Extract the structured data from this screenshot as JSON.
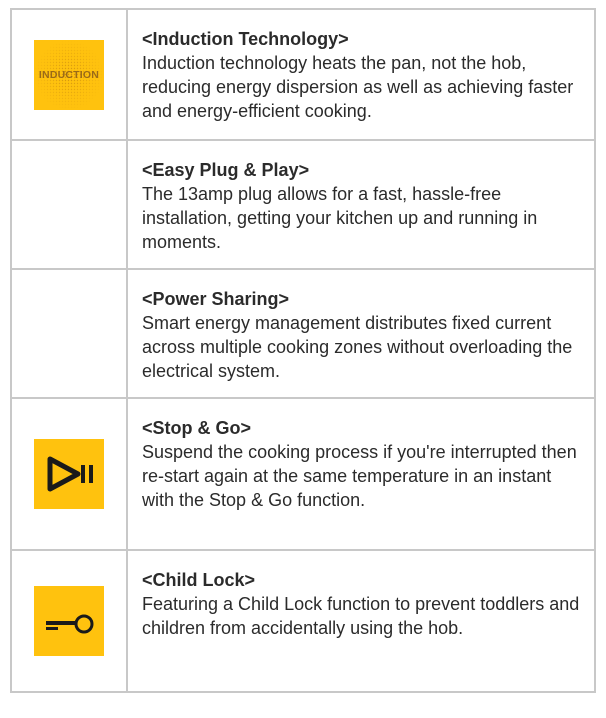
{
  "features": [
    {
      "icon": "induction-badge-icon",
      "icon_text": "INDUCTION",
      "title": "<Induction Technology>",
      "description": "Induction technology heats the pan, not the hob, reducing energy dispersion as well as achieving faster and energy-efficient cooking."
    },
    {
      "icon": "",
      "title": "<Easy Plug & Play>",
      "description": "The 13amp plug allows for a fast, hassle-free installation, getting your kitchen up and running in moments."
    },
    {
      "icon": "",
      "title": "<Power Sharing>",
      "description": "Smart energy management distributes fixed current across multiple cooking zones without overloading the electrical system."
    },
    {
      "icon": "play-pause-icon",
      "title": "<Stop & Go>",
      "description": "Suspend the cooking process if you're interrupted then re-start again at the same temperature in an instant with the Stop & Go function."
    },
    {
      "icon": "key-icon",
      "title": "<Child Lock>",
      "description": "Featuring a Child Lock function to prevent toddlers and children from accidentally using the hob."
    }
  ],
  "colors": {
    "icon_background": "#ffc20e",
    "icon_foreground": "#1a1a1a",
    "grid_line": "#c8c8c8"
  }
}
